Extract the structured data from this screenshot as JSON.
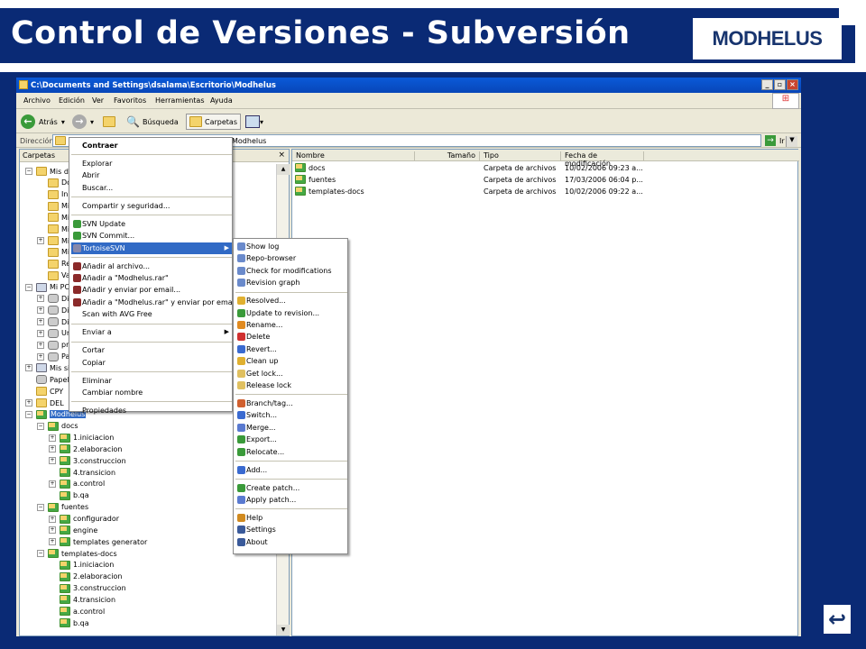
{
  "slide": {
    "title": "Control de Versiones - Subversión",
    "logo_text": "MODHELUS",
    "back_icon": "↩"
  },
  "window": {
    "title": "C:\\Documents and Settings\\dsalama\\Escritorio\\Modhelus",
    "menus": [
      "Archivo",
      "Edición",
      "Ver",
      "Favoritos",
      "Herramientas",
      "Ayuda"
    ],
    "toolbar": {
      "back": "Atrás",
      "search": "Búsqueda",
      "folders": "Carpetas"
    },
    "address": {
      "label": "Dirección",
      "value": "Modhelus",
      "go": "Ir"
    },
    "folders_panel": {
      "title": "Carpetas"
    }
  },
  "tree": [
    {
      "label": "Mis do",
      "indent": 0,
      "pm": "−",
      "icon": "folder"
    },
    {
      "label": "Do",
      "indent": 1,
      "pm": "",
      "icon": "folder"
    },
    {
      "label": "In",
      "indent": 1,
      "pm": "",
      "icon": "folder"
    },
    {
      "label": "Mi",
      "indent": 1,
      "pm": "",
      "icon": "folder"
    },
    {
      "label": "Mi",
      "indent": 1,
      "pm": "",
      "icon": "folder"
    },
    {
      "label": "Mi",
      "indent": 1,
      "pm": "",
      "icon": "folder"
    },
    {
      "label": "Mi",
      "indent": 1,
      "pm": "+",
      "icon": "folder"
    },
    {
      "label": "Mi",
      "indent": 1,
      "pm": "",
      "icon": "folder"
    },
    {
      "label": "Re",
      "indent": 1,
      "pm": "",
      "icon": "folder"
    },
    {
      "label": "Va",
      "indent": 1,
      "pm": "",
      "icon": "folder"
    },
    {
      "label": "Mi PC",
      "indent": 0,
      "pm": "−",
      "icon": "pc"
    },
    {
      "label": "Dis",
      "indent": 1,
      "pm": "+",
      "icon": "disk"
    },
    {
      "label": "Dis",
      "indent": 1,
      "pm": "+",
      "icon": "disk"
    },
    {
      "label": "Dis",
      "indent": 1,
      "pm": "+",
      "icon": "disk"
    },
    {
      "label": "Ur",
      "indent": 1,
      "pm": "+",
      "icon": "disk"
    },
    {
      "label": "pr",
      "indent": 1,
      "pm": "+",
      "icon": "disk"
    },
    {
      "label": "Pa",
      "indent": 1,
      "pm": "+",
      "icon": "disk"
    },
    {
      "label": "Mis sit",
      "indent": 0,
      "pm": "+",
      "icon": "pc"
    },
    {
      "label": "Papele",
      "indent": 0,
      "pm": "",
      "icon": "disk"
    },
    {
      "label": "CPY",
      "indent": 0,
      "pm": "",
      "icon": "folder"
    },
    {
      "label": "DEL",
      "indent": 0,
      "pm": "+",
      "icon": "folder"
    },
    {
      "label": "Modhelus",
      "indent": 0,
      "pm": "−",
      "icon": "svn",
      "selected": true
    },
    {
      "label": "docs",
      "indent": 1,
      "pm": "−",
      "icon": "svn"
    },
    {
      "label": "1.iniciacion",
      "indent": 2,
      "pm": "+",
      "icon": "svn"
    },
    {
      "label": "2.elaboracion",
      "indent": 2,
      "pm": "+",
      "icon": "svn"
    },
    {
      "label": "3.construccion",
      "indent": 2,
      "pm": "+",
      "icon": "svn"
    },
    {
      "label": "4.transicion",
      "indent": 2,
      "pm": "",
      "icon": "svn"
    },
    {
      "label": "a.control",
      "indent": 2,
      "pm": "+",
      "icon": "svn"
    },
    {
      "label": "b.qa",
      "indent": 2,
      "pm": "",
      "icon": "svn"
    },
    {
      "label": "fuentes",
      "indent": 1,
      "pm": "−",
      "icon": "svn"
    },
    {
      "label": "configurador",
      "indent": 2,
      "pm": "+",
      "icon": "svn"
    },
    {
      "label": "engine",
      "indent": 2,
      "pm": "+",
      "icon": "svn"
    },
    {
      "label": "templates generator",
      "indent": 2,
      "pm": "+",
      "icon": "svn"
    },
    {
      "label": "templates-docs",
      "indent": 1,
      "pm": "−",
      "icon": "svn"
    },
    {
      "label": "1.iniciacion",
      "indent": 2,
      "pm": "",
      "icon": "svn"
    },
    {
      "label": "2.elaboracion",
      "indent": 2,
      "pm": "",
      "icon": "svn"
    },
    {
      "label": "3.construccion",
      "indent": 2,
      "pm": "",
      "icon": "svn"
    },
    {
      "label": "4.transicion",
      "indent": 2,
      "pm": "",
      "icon": "svn"
    },
    {
      "label": "a.control",
      "indent": 2,
      "pm": "",
      "icon": "svn"
    },
    {
      "label": "b.qa",
      "indent": 2,
      "pm": "",
      "icon": "svn"
    }
  ],
  "files": {
    "columns": [
      "Nombre",
      "Tamaño",
      "Tipo",
      "Fecha de modificación"
    ],
    "rows": [
      {
        "name": "docs",
        "size": "",
        "type": "Carpeta de archivos",
        "date": "10/02/2006 09:23 a..."
      },
      {
        "name": "fuentes",
        "size": "",
        "type": "Carpeta de archivos",
        "date": "17/03/2006 06:04 p..."
      },
      {
        "name": "templates-docs",
        "size": "",
        "type": "Carpeta de archivos",
        "date": "10/02/2006 09:22 a..."
      }
    ]
  },
  "context_menu": [
    {
      "label": "Contraer",
      "bold": true
    },
    {
      "sep": true
    },
    {
      "label": "Explorar"
    },
    {
      "label": "Abrir"
    },
    {
      "label": "Buscar..."
    },
    {
      "sep": true
    },
    {
      "label": "Compartir y seguridad..."
    },
    {
      "sep": true
    },
    {
      "label": "SVN Update",
      "icon": "#3a9a3a"
    },
    {
      "label": "SVN Commit...",
      "icon": "#3a9a3a"
    },
    {
      "label": "TortoiseSVN",
      "icon": "#8888aa",
      "sub": true,
      "hl": true
    },
    {
      "sep": true
    },
    {
      "label": "Añadir al archivo...",
      "icon": "#8b2a2a"
    },
    {
      "label": "Añadir a \"Modhelus.rar\"",
      "icon": "#8b2a2a"
    },
    {
      "label": "Añadir y enviar por email...",
      "icon": "#8b2a2a"
    },
    {
      "label": "Añadir a \"Modhelus.rar\" y enviar por email",
      "icon": "#8b2a2a"
    },
    {
      "label": "Scan with AVG Free"
    },
    {
      "sep": true
    },
    {
      "label": "Enviar a",
      "sub": true
    },
    {
      "sep": true
    },
    {
      "label": "Cortar"
    },
    {
      "label": "Copiar"
    },
    {
      "sep": true
    },
    {
      "label": "Eliminar"
    },
    {
      "label": "Cambiar nombre"
    },
    {
      "sep": true
    },
    {
      "label": "Propiedades"
    }
  ],
  "submenu": [
    {
      "label": "Show log",
      "icon": "#6a8acb"
    },
    {
      "label": "Repo-browser",
      "icon": "#6a8acb"
    },
    {
      "label": "Check for modifications",
      "icon": "#6a8acb"
    },
    {
      "label": "Revision graph",
      "icon": "#6a8acb"
    },
    {
      "sep": true
    },
    {
      "label": "Resolved...",
      "icon": "#e0b030"
    },
    {
      "label": "Update to revision...",
      "icon": "#3a9a3a"
    },
    {
      "label": "Rename...",
      "icon": "#e08a20"
    },
    {
      "label": "Delete",
      "icon": "#d03030"
    },
    {
      "label": "Revert...",
      "icon": "#3a6ad0"
    },
    {
      "label": "Clean up",
      "icon": "#e0b030"
    },
    {
      "label": "Get lock...",
      "icon": "#e0c060"
    },
    {
      "label": "Release lock",
      "icon": "#e0c060"
    },
    {
      "sep": true
    },
    {
      "label": "Branch/tag...",
      "icon": "#d06030"
    },
    {
      "label": "Switch...",
      "icon": "#3a6ad0"
    },
    {
      "label": "Merge...",
      "icon": "#5a7ad0"
    },
    {
      "label": "Export...",
      "icon": "#3a9a3a"
    },
    {
      "label": "Relocate...",
      "icon": "#3a9a3a"
    },
    {
      "sep": true
    },
    {
      "label": "Add...",
      "icon": "#3a6ad0"
    },
    {
      "sep": true
    },
    {
      "label": "Create patch...",
      "icon": "#3a9a3a"
    },
    {
      "label": "Apply patch...",
      "icon": "#5a7ad0"
    },
    {
      "sep": true
    },
    {
      "label": "Help",
      "icon": "#d08a20"
    },
    {
      "label": "Settings",
      "icon": "#3a5a9a"
    },
    {
      "label": "About",
      "icon": "#3a5a9a"
    }
  ]
}
